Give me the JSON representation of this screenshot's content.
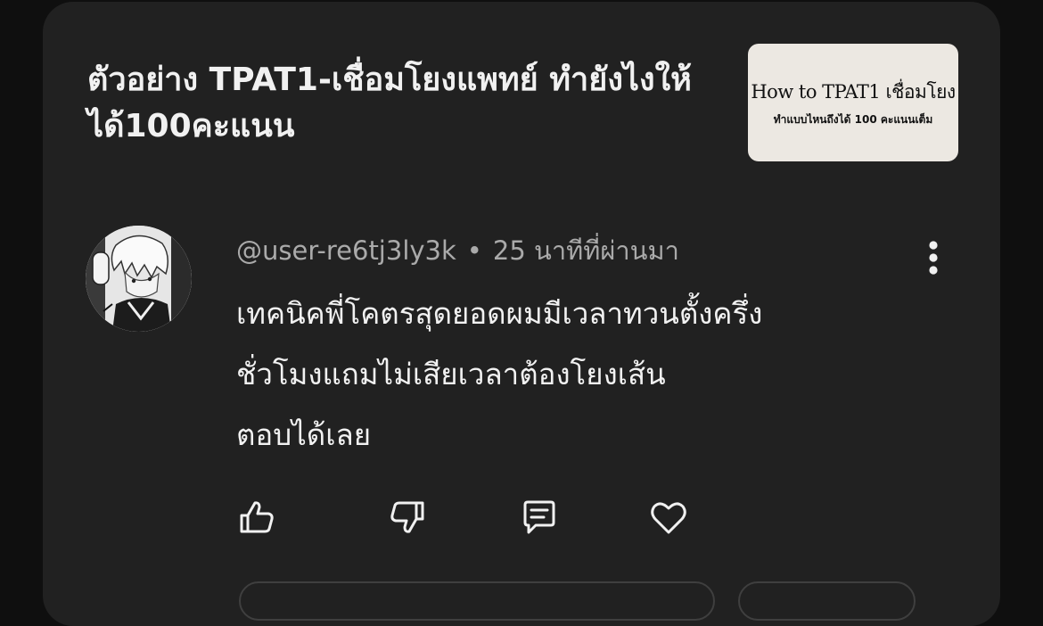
{
  "video": {
    "title": "ตัวอย่าง TPAT1-เชื่อมโยงแพทย์ ทำยังไงให้ได้100คะแนน",
    "thumbnail_title": "How to TPAT1 เชื่อมโยง",
    "thumbnail_subtitle": "ทำแบบไหนถึงได้ 100 คะแนนเต็ม"
  },
  "comment": {
    "author": "@user-re6tj3ly3k",
    "separator": "•",
    "time": "25 นาทีที่ผ่านมา",
    "lines": [
      "เทคนิคพี่โคตรสุดยอดผมมีเวลาทวนตั้งครึ่ง",
      "ชั่วโมงแถมไม่เสียเวลาต้องโยงเส้น",
      "ตอบได้เลย"
    ],
    "avatar_icon": "anime-avatar-icon",
    "menu_icon": "more-vertical-icon"
  },
  "actions": [
    {
      "name": "like",
      "icon": "thumbs-up-icon"
    },
    {
      "name": "dislike",
      "icon": "thumbs-down-icon"
    },
    {
      "name": "reply",
      "icon": "reply-comment-icon"
    },
    {
      "name": "heart",
      "icon": "heart-icon"
    }
  ],
  "colors": {
    "background": "#0f0f0f",
    "card": "#212121",
    "text_primary": "#f1f1f1",
    "text_secondary": "#aaaaaa",
    "thumbnail_bg": "#ece8e2"
  }
}
